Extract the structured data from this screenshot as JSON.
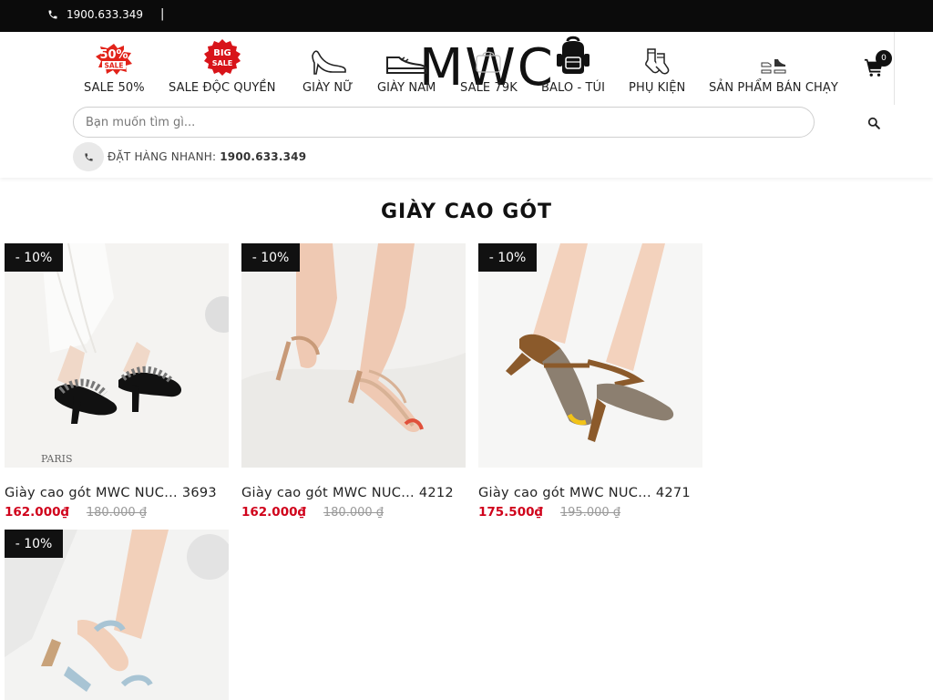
{
  "topbar": {
    "phone": "1900.633.349",
    "separator": "|"
  },
  "header": {
    "logo": "MWC",
    "nav": [
      {
        "label": "SALE 50%",
        "icon": "sale-50-icon"
      },
      {
        "label": "SALE ĐỘC QUYỀN",
        "icon": "big-sale-icon"
      },
      {
        "label": "GIÀY NỮ",
        "icon": "high-heel-icon"
      },
      {
        "label": "GIÀY NAM",
        "icon": "sneaker-icon"
      },
      {
        "label": "SALE 79K",
        "icon": "sale-79k-icon"
      },
      {
        "label": "BALO - TÚI",
        "icon": "backpack-icon"
      },
      {
        "label": "PHỤ KIỆN",
        "icon": "socks-icon"
      },
      {
        "label": "SẢN PHẨM BÁN CHẠY",
        "icon": "bestseller-shoes-icon"
      }
    ],
    "cart_count": "0",
    "search": {
      "placeholder": "Bạn muốn tìm gì..."
    },
    "order": {
      "label": "ĐẶT HÀNG NHANH:",
      "number": "1900.633.349"
    }
  },
  "section": {
    "title": "GIÀY CAO GÓT"
  },
  "products": [
    {
      "badge": "- 10%",
      "name": "Giày cao gót MWC NUC... 3693",
      "price": "162.000₫",
      "old_price": "180.000 ₫",
      "img": "black-slingback-heel-image"
    },
    {
      "badge": "- 10%",
      "name": "Giày cao gót MWC NUC... 4212",
      "price": "162.000₫",
      "old_price": "180.000 ₫",
      "img": "nude-strappy-sandal-image"
    },
    {
      "badge": "- 10%",
      "name": "Giày cao gót MWC NUC... 4271",
      "price": "175.500₫",
      "old_price": "195.000 ₫",
      "img": "houndstooth-block-heel-image"
    },
    {
      "badge": "- 10%",
      "img": "blue-strap-heel-image"
    }
  ],
  "colors": {
    "topbar": "#0b0b0b",
    "price": "#d0021b",
    "old_price": "#999999",
    "badge": "#111111"
  }
}
